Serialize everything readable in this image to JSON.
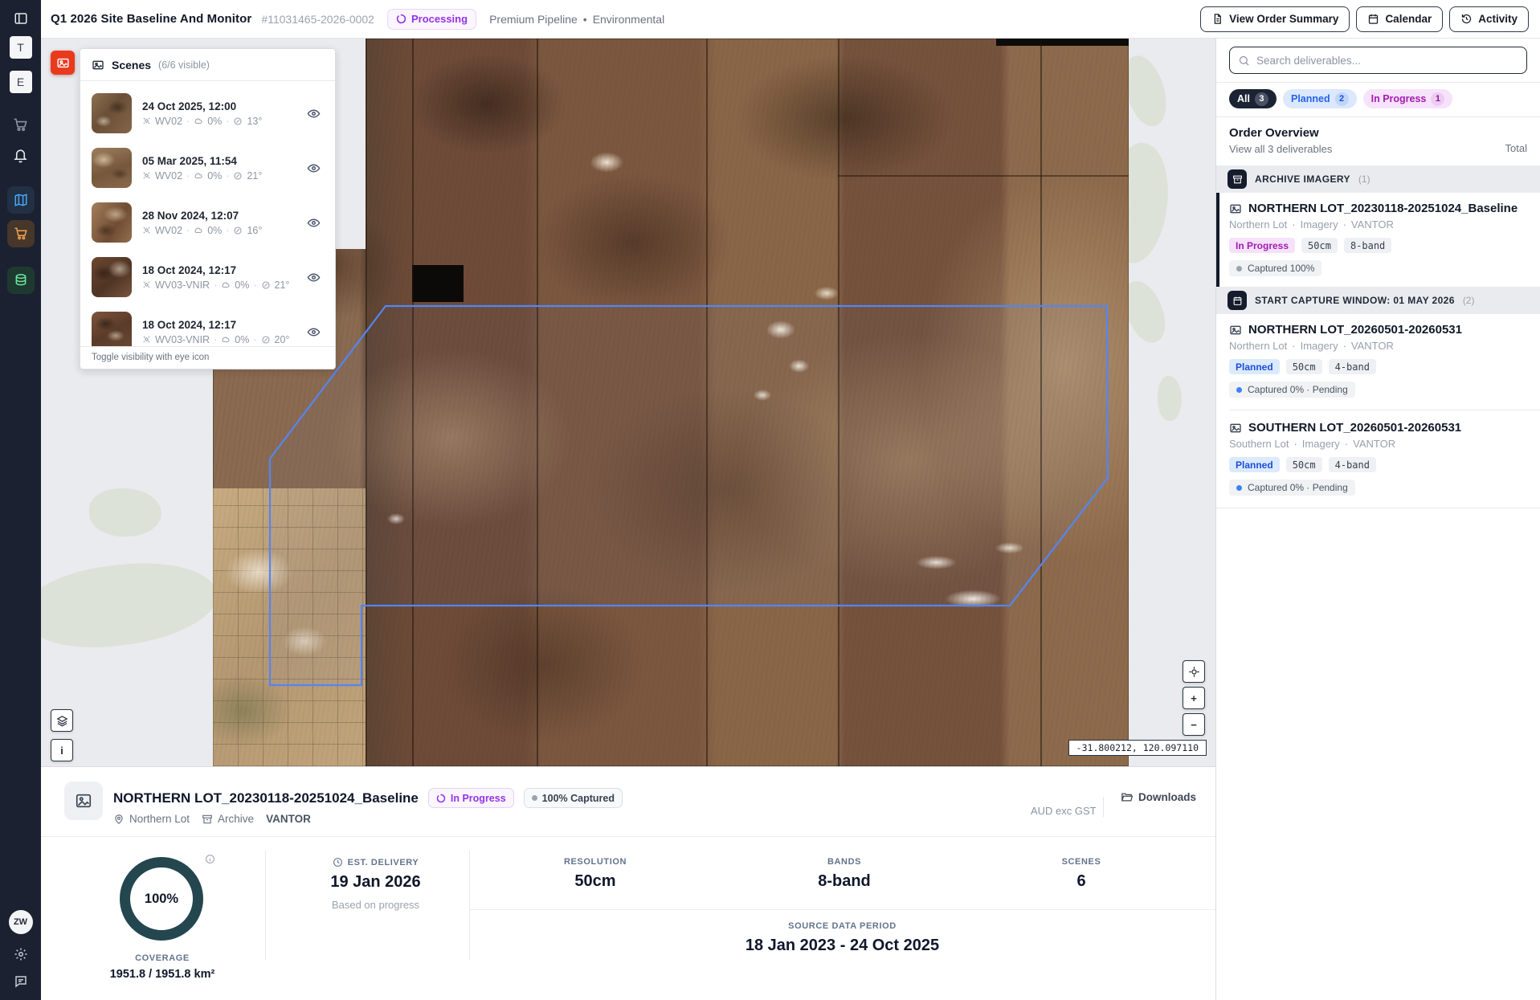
{
  "ui": {
    "dot": "·",
    "bullet": "•",
    "plus": "+",
    "minus": "−",
    "info_i": "i"
  },
  "topbar": {
    "title": "Q1 2026 Site Baseline And Monitor",
    "order_id": "#11031465-2026-0002",
    "status": "Processing",
    "pipeline": "Premium Pipeline",
    "category": "Environmental",
    "view_order_summary": "View Order Summary",
    "calendar": "Calendar",
    "activity": "Activity"
  },
  "rail": {
    "team_initial": "T",
    "env_initial": "E",
    "avatar_initials": "ZW"
  },
  "scenes_panel": {
    "title": "Scenes",
    "visible_count": "(6/6 visible)",
    "footer": "Toggle visibility with eye icon",
    "items": [
      {
        "date": "24 Oct 2025, 12:00",
        "satellite": "WV02",
        "cloud": "0%",
        "angle": "13°"
      },
      {
        "date": "05 Mar 2025, 11:54",
        "satellite": "WV02",
        "cloud": "0%",
        "angle": "21°"
      },
      {
        "date": "28 Nov 2024, 12:07",
        "satellite": "WV02",
        "cloud": "0%",
        "angle": "16°"
      },
      {
        "date": "18 Oct 2024, 12:17",
        "satellite": "WV03-VNIR",
        "cloud": "0%",
        "angle": "21°"
      },
      {
        "date": "18 Oct 2024, 12:17",
        "satellite": "WV03-VNIR",
        "cloud": "0%",
        "angle": "20°"
      }
    ]
  },
  "map": {
    "coordinates": "-31.800212, 120.097110"
  },
  "right_panel": {
    "search_placeholder": "Search deliverables...",
    "filters": [
      {
        "label": "All",
        "count": "3"
      },
      {
        "label": "Planned",
        "count": "2"
      },
      {
        "label": "In Progress",
        "count": "1"
      }
    ],
    "overview": {
      "title": "Order Overview",
      "subtitle": "View all 3 deliverables",
      "total_label": "Total"
    },
    "sections": [
      {
        "title": "ARCHIVE IMAGERY",
        "count": "(1)"
      },
      {
        "title": "START CAPTURE WINDOW: 01 MAY 2026",
        "count": "(2)"
      }
    ],
    "deliverables": [
      {
        "name": "NORTHERN LOT_20230118-20251024_Baseline",
        "lot": "Northern Lot",
        "type": "Imagery",
        "provider": "VANTOR",
        "status": "In Progress",
        "resolution": "50cm",
        "bands": "8-band",
        "capture": "Captured 100%"
      },
      {
        "name": "NORTHERN LOT_20260501-20260531",
        "lot": "Northern Lot",
        "type": "Imagery",
        "provider": "VANTOR",
        "status": "Planned",
        "resolution": "50cm",
        "bands": "4-band",
        "capture": "Captured 0% · Pending"
      },
      {
        "name": "SOUTHERN LOT_20260501-20260531",
        "lot": "Southern Lot",
        "type": "Imagery",
        "provider": "VANTOR",
        "status": "Planned",
        "resolution": "50cm",
        "bands": "4-band",
        "capture": "Captured 0% · Pending"
      }
    ]
  },
  "detail": {
    "title": "NORTHERN LOT_20230118-20251024_Baseline",
    "status": "In Progress",
    "captured": "100% Captured",
    "lot": "Northern Lot",
    "source": "Archive",
    "provider": "VANTOR",
    "currency": "AUD exc GST",
    "downloads": "Downloads",
    "coverage": {
      "pct": "100%",
      "label": "COVERAGE",
      "value": "1951.8 / 1951.8 km²"
    },
    "delivery": {
      "label": "EST. DELIVERY",
      "value": "19 Jan 2026",
      "note": "Based on progress"
    },
    "resolution": {
      "label": "RESOLUTION",
      "value": "50cm"
    },
    "bands": {
      "label": "BANDS",
      "value": "8-band"
    },
    "scenes": {
      "label": "SCENES",
      "value": "6"
    },
    "period": {
      "label": "SOURCE DATA PERIOD",
      "value": "18 Jan 2023 - 24 Oct 2025"
    }
  },
  "colors": {
    "accent_purple": "#9333ea",
    "accent_blue": "#2563eb",
    "dark_navy": "#1b2130",
    "teal_donut": "#24464f",
    "aoi_blue": "#5585f2",
    "alert_red": "#e93a1e"
  }
}
